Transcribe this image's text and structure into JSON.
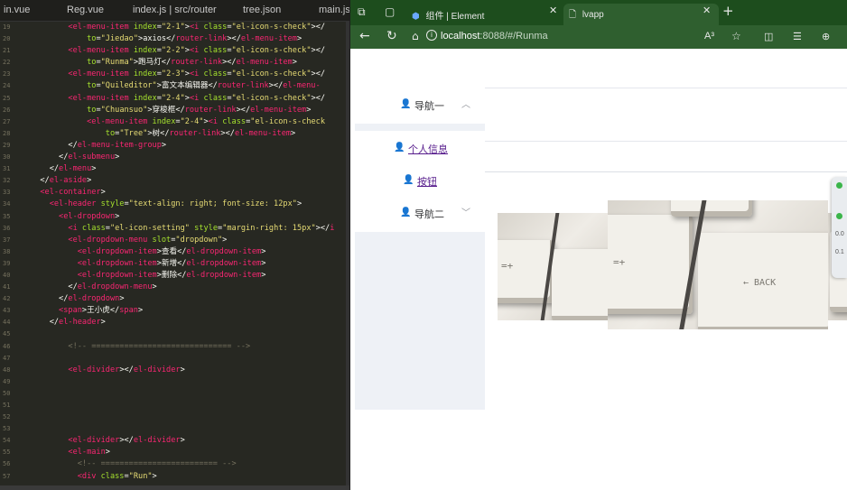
{
  "editor": {
    "tabs": [
      "in.vue",
      "Reg.vue",
      "index.js | src/router",
      "tree.json",
      "main.js"
    ],
    "lines": [
      {
        "n": "19",
        "parts": [
          [
            "tg",
            "        <el-menu-item "
          ],
          [
            "at",
            "index"
          ],
          [
            "tx",
            "="
          ],
          [
            "st",
            "\"2-1\""
          ],
          [
            "tx",
            ">"
          ],
          [
            "tg",
            "<i "
          ],
          [
            "at",
            "class"
          ],
          [
            "tx",
            "="
          ],
          [
            "st",
            "\"el-icon-s-check\""
          ],
          [
            "tx",
            "></"
          ]
        ]
      },
      {
        "n": "20",
        "parts": [
          [
            "at",
            "            to"
          ],
          [
            "tx",
            "="
          ],
          [
            "st",
            "\"Jiedao\""
          ],
          [
            "tx",
            ">axios</"
          ],
          [
            "tg",
            "router-link"
          ],
          [
            "tx",
            "></"
          ],
          [
            "tg",
            "el-menu-item"
          ],
          [
            "tx",
            ">"
          ]
        ]
      },
      {
        "n": "21",
        "parts": [
          [
            "tg",
            "        <el-menu-item "
          ],
          [
            "at",
            "index"
          ],
          [
            "tx",
            "="
          ],
          [
            "st",
            "\"2-2\""
          ],
          [
            "tx",
            ">"
          ],
          [
            "tg",
            "<i "
          ],
          [
            "at",
            "class"
          ],
          [
            "tx",
            "="
          ],
          [
            "st",
            "\"el-icon-s-check\""
          ],
          [
            "tx",
            "></"
          ]
        ]
      },
      {
        "n": "22",
        "parts": [
          [
            "at",
            "            to"
          ],
          [
            "tx",
            "="
          ],
          [
            "st",
            "\"Runma\""
          ],
          [
            "tx",
            ">跑马灯</"
          ],
          [
            "tg",
            "router-link"
          ],
          [
            "tx",
            "></"
          ],
          [
            "tg",
            "el-menu-item"
          ],
          [
            "tx",
            ">"
          ]
        ]
      },
      {
        "n": "23",
        "parts": [
          [
            "tg",
            "        <el-menu-item "
          ],
          [
            "at",
            "index"
          ],
          [
            "tx",
            "="
          ],
          [
            "st",
            "\"2-3\""
          ],
          [
            "tx",
            ">"
          ],
          [
            "tg",
            "<i "
          ],
          [
            "at",
            "class"
          ],
          [
            "tx",
            "="
          ],
          [
            "st",
            "\"el-icon-s-check\""
          ],
          [
            "tx",
            "></"
          ]
        ]
      },
      {
        "n": "24",
        "parts": [
          [
            "at",
            "            to"
          ],
          [
            "tx",
            "="
          ],
          [
            "st",
            "\"Quileditor\""
          ],
          [
            "tx",
            ">富文本编辑器</"
          ],
          [
            "tg",
            "router-link"
          ],
          [
            "tx",
            "></"
          ],
          [
            "tg",
            "el-menu-"
          ]
        ]
      },
      {
        "n": "25",
        "parts": [
          [
            "tg",
            "        <el-menu-item "
          ],
          [
            "at",
            "index"
          ],
          [
            "tx",
            "="
          ],
          [
            "st",
            "\"2-4\""
          ],
          [
            "tx",
            ">"
          ],
          [
            "tg",
            "<i "
          ],
          [
            "at",
            "class"
          ],
          [
            "tx",
            "="
          ],
          [
            "st",
            "\"el-icon-s-check\""
          ],
          [
            "tx",
            "></"
          ]
        ]
      },
      {
        "n": "26",
        "parts": [
          [
            "at",
            "            to"
          ],
          [
            "tx",
            "="
          ],
          [
            "st",
            "\"Chuansuo\""
          ],
          [
            "tx",
            ">穿梭框</"
          ],
          [
            "tg",
            "router-link"
          ],
          [
            "tx",
            "></"
          ],
          [
            "tg",
            "el-menu-item"
          ],
          [
            "tx",
            ">"
          ]
        ]
      },
      {
        "n": "27",
        "parts": [
          [
            "tg",
            "            <el-menu-item "
          ],
          [
            "at",
            "index"
          ],
          [
            "tx",
            "="
          ],
          [
            "st",
            "\"2-4\""
          ],
          [
            "tx",
            ">"
          ],
          [
            "tg",
            "<i "
          ],
          [
            "at",
            "class"
          ],
          [
            "tx",
            "="
          ],
          [
            "st",
            "\"el-icon-s-check"
          ]
        ]
      },
      {
        "n": "28",
        "parts": [
          [
            "at",
            "                to"
          ],
          [
            "tx",
            "="
          ],
          [
            "st",
            "\"Tree\""
          ],
          [
            "tx",
            ">树</"
          ],
          [
            "tg",
            "router-link"
          ],
          [
            "tx",
            "></"
          ],
          [
            "tg",
            "el-menu-item"
          ],
          [
            "tx",
            ">"
          ]
        ]
      },
      {
        "n": "29",
        "parts": [
          [
            "tx",
            "        </"
          ],
          [
            "tg",
            "el-menu-item-group"
          ],
          [
            "tx",
            ">"
          ]
        ]
      },
      {
        "n": "30",
        "parts": [
          [
            "tx",
            "      </"
          ],
          [
            "tg",
            "el-submenu"
          ],
          [
            "tx",
            ">"
          ]
        ]
      },
      {
        "n": "31",
        "parts": [
          [
            "tx",
            "    </"
          ],
          [
            "tg",
            "el-menu"
          ],
          [
            "tx",
            ">"
          ]
        ]
      },
      {
        "n": "32",
        "parts": [
          [
            "tx",
            "  </"
          ],
          [
            "tg",
            "el-aside"
          ],
          [
            "tx",
            ">"
          ]
        ]
      },
      {
        "n": "33",
        "parts": [
          [
            "tg",
            "  <el-container"
          ],
          [
            "tx",
            ">"
          ]
        ]
      },
      {
        "n": "34",
        "parts": [
          [
            "tg",
            "    <el-header "
          ],
          [
            "at",
            "style"
          ],
          [
            "tx",
            "="
          ],
          [
            "st",
            "\"text-align: right; font-size: 12px\""
          ],
          [
            "tx",
            ">"
          ]
        ]
      },
      {
        "n": "35",
        "parts": [
          [
            "tg",
            "      <el-dropdown"
          ],
          [
            "tx",
            ">"
          ]
        ]
      },
      {
        "n": "36",
        "parts": [
          [
            "tg",
            "        <i "
          ],
          [
            "at",
            "class"
          ],
          [
            "tx",
            "="
          ],
          [
            "st",
            "\"el-icon-setting\" "
          ],
          [
            "at",
            "style"
          ],
          [
            "tx",
            "="
          ],
          [
            "st",
            "\"margin-right: 15px\""
          ],
          [
            "tx",
            "></"
          ],
          [
            "tg",
            "i"
          ]
        ]
      },
      {
        "n": "37",
        "parts": [
          [
            "tg",
            "        <el-dropdown-menu "
          ],
          [
            "at",
            "slot"
          ],
          [
            "tx",
            "="
          ],
          [
            "st",
            "\"dropdown\""
          ],
          [
            "tx",
            ">"
          ]
        ]
      },
      {
        "n": "38",
        "parts": [
          [
            "tg",
            "          <el-dropdown-item"
          ],
          [
            "tx",
            ">查看</"
          ],
          [
            "tg",
            "el-dropdown-item"
          ],
          [
            "tx",
            ">"
          ]
        ]
      },
      {
        "n": "39",
        "parts": [
          [
            "tg",
            "          <el-dropdown-item"
          ],
          [
            "tx",
            ">新增</"
          ],
          [
            "tg",
            "el-dropdown-item"
          ],
          [
            "tx",
            ">"
          ]
        ]
      },
      {
        "n": "40",
        "parts": [
          [
            "tg",
            "          <el-dropdown-item"
          ],
          [
            "tx",
            ">删除</"
          ],
          [
            "tg",
            "el-dropdown-item"
          ],
          [
            "tx",
            ">"
          ]
        ]
      },
      {
        "n": "41",
        "parts": [
          [
            "tx",
            "        </"
          ],
          [
            "tg",
            "el-dropdown-menu"
          ],
          [
            "tx",
            ">"
          ]
        ]
      },
      {
        "n": "42",
        "parts": [
          [
            "tx",
            "      </"
          ],
          [
            "tg",
            "el-dropdown"
          ],
          [
            "tx",
            ">"
          ]
        ]
      },
      {
        "n": "43",
        "parts": [
          [
            "tg",
            "      <span"
          ],
          [
            "tx",
            ">王小虎</"
          ],
          [
            "tg",
            "span"
          ],
          [
            "tx",
            ">"
          ]
        ]
      },
      {
        "n": "44",
        "parts": [
          [
            "tx",
            "    </"
          ],
          [
            "tg",
            "el-header"
          ],
          [
            "tx",
            ">"
          ]
        ]
      },
      {
        "n": "45",
        "parts": []
      },
      {
        "n": "46",
        "parts": [
          [
            "cm",
            "        <!-- ============================== -->"
          ]
        ]
      },
      {
        "n": "47",
        "parts": []
      },
      {
        "n": "48",
        "parts": [
          [
            "tg",
            "        <el-divider"
          ],
          [
            "tx",
            "></"
          ],
          [
            "tg",
            "el-divider"
          ],
          [
            "tx",
            ">"
          ]
        ]
      },
      {
        "n": "49",
        "parts": []
      },
      {
        "n": "50",
        "parts": []
      },
      {
        "n": "51",
        "parts": []
      },
      {
        "n": "52",
        "parts": []
      },
      {
        "n": "53",
        "parts": []
      },
      {
        "n": "54",
        "parts": [
          [
            "tg",
            "        <el-divider"
          ],
          [
            "tx",
            "></"
          ],
          [
            "tg",
            "el-divider"
          ],
          [
            "tx",
            ">"
          ]
        ]
      },
      {
        "n": "55",
        "parts": [
          [
            "tg",
            "        <el-main"
          ],
          [
            "tx",
            ">"
          ]
        ]
      },
      {
        "n": "56",
        "parts": [
          [
            "cm",
            "          <!-- ========================= -->"
          ]
        ]
      },
      {
        "n": "57",
        "parts": [
          [
            "tg",
            "          <div "
          ],
          [
            "at",
            "class"
          ],
          [
            "tx",
            "="
          ],
          [
            "st",
            "\"Run\""
          ],
          [
            "tx",
            ">"
          ]
        ]
      }
    ]
  },
  "browser": {
    "tabs": [
      {
        "title": "组件 | Element",
        "active": false
      },
      {
        "title": "lvapp",
        "active": true
      }
    ],
    "url_host": "localhost",
    "url_rest": ":8088/#/Runma",
    "reader_label": "A³",
    "colors": {
      "tabbar": "#1d4d1d",
      "addrbar": "#2f5f2f"
    }
  },
  "sidebar": {
    "nav1": "导航一",
    "items": [
      "个人信息",
      "按钮"
    ],
    "nav2": "导航二"
  },
  "carousel": {
    "slide_count": 3,
    "active_index": 0
  },
  "side_panel": {
    "texts": [
      "0.0",
      "0.1"
    ]
  }
}
